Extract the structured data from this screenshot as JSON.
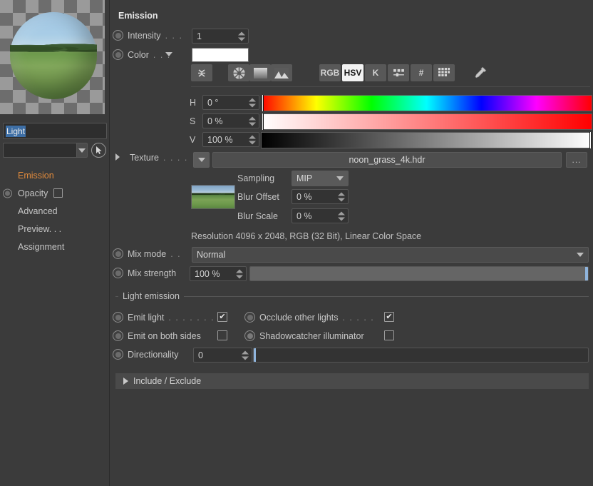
{
  "left_panel": {
    "preview_name": "material-preview",
    "material_name_field": {
      "value": "Light",
      "placeholder": ""
    },
    "nav_items": [
      {
        "label": "Emission",
        "active": true,
        "has_radio": false,
        "has_checkbox": false
      },
      {
        "label": "Opacity",
        "active": false,
        "has_radio": true,
        "has_checkbox": true
      },
      {
        "label": "Advanced",
        "active": false,
        "has_radio": false,
        "has_checkbox": false
      },
      {
        "label": "Preview. . .",
        "active": false,
        "has_radio": false,
        "has_checkbox": false
      },
      {
        "label": "Assignment",
        "active": false,
        "has_radio": false,
        "has_checkbox": false
      }
    ]
  },
  "main": {
    "section_title": "Emission",
    "intensity": {
      "label": "Intensity",
      "dots": ". . .",
      "value": "1"
    },
    "color": {
      "label": "Color",
      "dots": ". . .",
      "swatch_hex": "#ffffff"
    },
    "color_mode_buttons": [
      {
        "name": "RGB",
        "label": "RGB",
        "active": false
      },
      {
        "name": "HSV",
        "label": "HSV",
        "active": true
      },
      {
        "name": "K",
        "label": "K",
        "active": false
      },
      {
        "name": "sliders",
        "label": "",
        "active": false
      },
      {
        "name": "hex",
        "label": "#",
        "active": false
      },
      {
        "name": "swatches",
        "label": "",
        "active": false
      }
    ],
    "picker_icons": [
      "collapse-icon",
      "colorwheel-icon",
      "gradient-icon",
      "image-icon",
      "eyedropper-icon"
    ],
    "hsv": [
      {
        "channel": "H",
        "value": "0 °",
        "handle_pct": 0,
        "gradient": "hue"
      },
      {
        "channel": "S",
        "value": "0 %",
        "handle_pct": 0,
        "gradient": "sat"
      },
      {
        "channel": "V",
        "value": "100 %",
        "handle_pct": 100,
        "gradient": "val"
      }
    ],
    "texture": {
      "label": "Texture",
      "dots": ". . . .",
      "filename": "noon_grass_4k.hdr",
      "browse_label": "...",
      "sampling": {
        "label": "Sampling",
        "value": "MIP"
      },
      "blur_offset": {
        "label": "Blur Offset",
        "value": "0 %"
      },
      "blur_scale": {
        "label": "Blur Scale",
        "value": "0 %"
      },
      "resolution_text": "Resolution 4096 x 2048, RGB (32 Bit), Linear Color Space"
    },
    "mix_mode": {
      "label": "Mix mode",
      "dots": ". .",
      "value": "Normal"
    },
    "mix_strength": {
      "label": "Mix strength",
      "value": "100 %",
      "fill_pct": 100
    },
    "light_emission": {
      "group_label": "Light emission",
      "emit_light": {
        "label": "Emit light",
        "dots": ". . . . . . .",
        "checked": true
      },
      "occlude_other_lights": {
        "label": "Occlude other lights",
        "dots": ". . . . .",
        "checked": true
      },
      "emit_on_both_sides": {
        "label": "Emit on both sides",
        "checked": false
      },
      "shadowcatcher_illuminator": {
        "label": "Shadowcatcher illuminator",
        "checked": false
      },
      "directionality": {
        "label": "Directionality",
        "value": "0",
        "handle_pct": 0
      }
    },
    "include_exclude": {
      "label": "Include / Exclude"
    }
  },
  "colors": {
    "accent_orange": "#e08a3c",
    "panel_bg": "#3b3b3b",
    "field_bg": "#333333",
    "selection_blue": "#3d6ea5"
  }
}
